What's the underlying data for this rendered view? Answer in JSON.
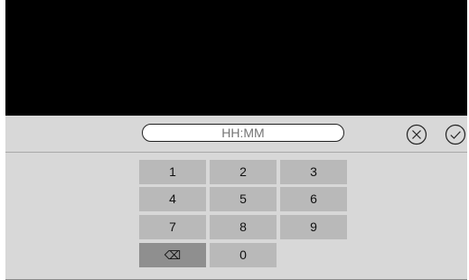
{
  "time_input": {
    "placeholder": "HH:MM",
    "value": ""
  },
  "actions": {
    "cancel_icon": "close-circle-icon",
    "confirm_icon": "check-circle-icon"
  },
  "keypad": {
    "k1": "1",
    "k2": "2",
    "k3": "3",
    "k4": "4",
    "k5": "5",
    "k6": "6",
    "k7": "7",
    "k8": "8",
    "k9": "9",
    "backspace_glyph": "⌫",
    "k0": "0"
  },
  "colors": {
    "panel": "#d8d8d8",
    "key": "#b9b9b9",
    "key_dark": "#8f8f8f",
    "viewport": "#000000"
  }
}
